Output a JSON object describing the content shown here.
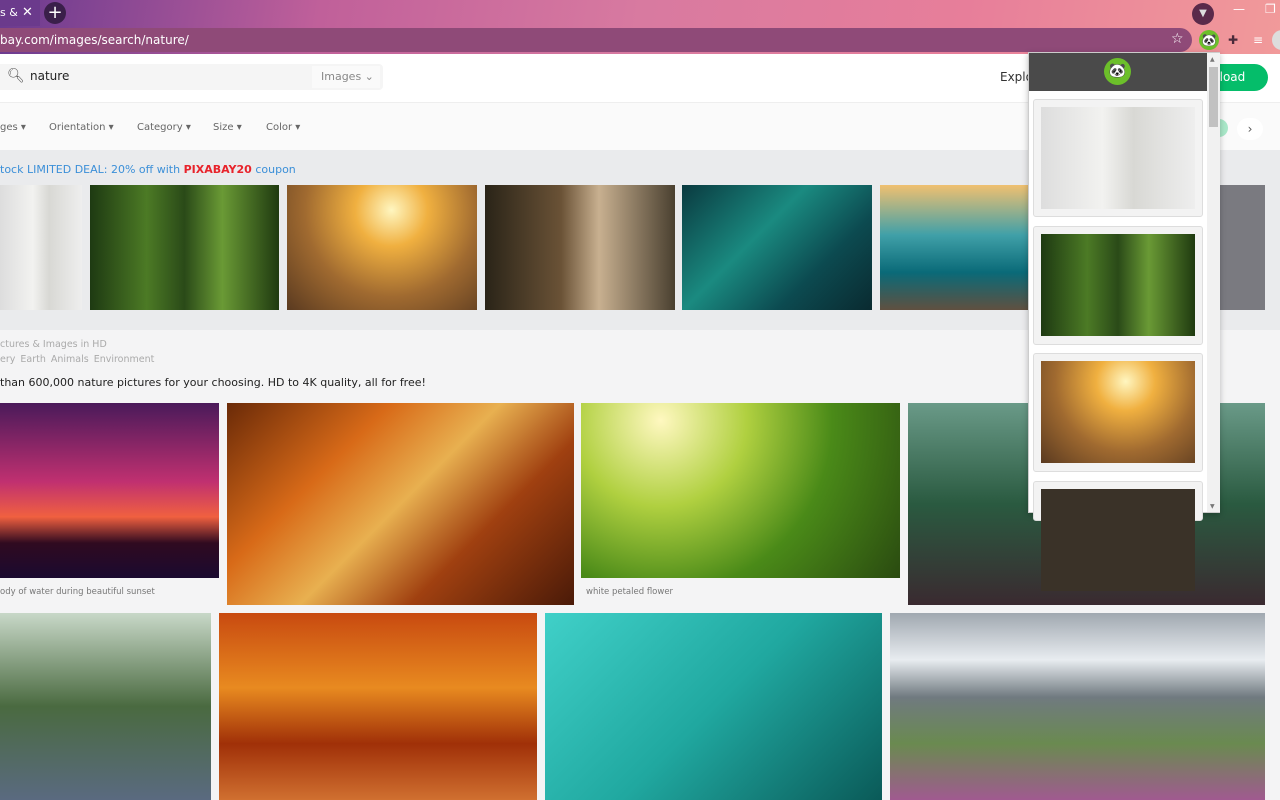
{
  "browser": {
    "tab_title": "s &",
    "new_tab": "+",
    "url": "bay.com/images/search/nature/"
  },
  "search": {
    "value": "nature",
    "type_select": "Images"
  },
  "header": {
    "explore": "Explo",
    "upload": "pload"
  },
  "filters": [
    "ges",
    "Orientation",
    "Category",
    "Size",
    "Color"
  ],
  "promo": {
    "prefix": "tock LIMITED DEAL: 20% off with ",
    "code": "PIXABAY20",
    "suffix": " coupon"
  },
  "section": {
    "heading": "ctures & Images in HD",
    "tags": [
      "ery",
      "Earth",
      "Animals",
      "Environment"
    ],
    "description": " than 600,000 nature pictures for your choosing. HD to 4K quality, all for free!"
  },
  "captions": {
    "sunset": "ody of water during beautiful sunset",
    "flower": "white petaled flower"
  },
  "colors": {
    "accent": "#05bd6a",
    "promo_link": "#3b8fd8",
    "promo_code": "#e8232b",
    "popup_header": "#4a4a4a"
  }
}
